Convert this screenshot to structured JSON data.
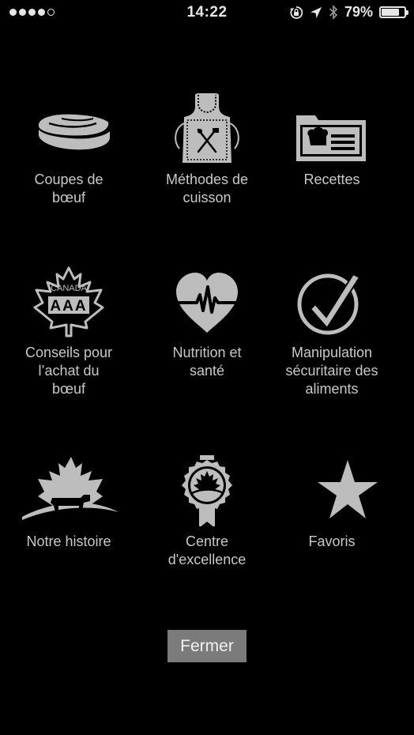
{
  "status_bar": {
    "signal_bars_filled": 4,
    "signal_bars_total": 5,
    "time": "14:22",
    "icons": [
      "orientation-lock-icon",
      "location-arrow-icon",
      "bluetooth-icon"
    ],
    "battery_percent": "79%",
    "battery_level": 0.79
  },
  "menu": {
    "items": [
      {
        "label": "Coupes de\nbœuf",
        "icon": "steak-icon"
      },
      {
        "label": "Méthodes de\ncuisson",
        "icon": "apron-icon"
      },
      {
        "label": "Recettes",
        "icon": "recipe-folder-icon"
      },
      {
        "label": "Conseils pour\nl’achat du\nbœuf",
        "icon": "canada-aaa-maple-icon",
        "icon_text_top": "CANADA",
        "icon_text_grade": "AAA"
      },
      {
        "label": "Nutrition et\nsanté",
        "icon": "heart-pulse-icon"
      },
      {
        "label": "Manipulation\nsécuritaire des\naliments",
        "icon": "checkmark-circle-icon"
      },
      {
        "label": "Notre histoire",
        "icon": "maple-leaf-cow-icon"
      },
      {
        "label": "Centre\nd'excellence",
        "icon": "award-medal-icon"
      },
      {
        "label": "Favoris",
        "icon": "star-icon"
      }
    ]
  },
  "close_button": {
    "label": "Fermer"
  },
  "colors": {
    "background": "#000000",
    "icon": "#bdbdbd",
    "text": "#c9c9c9",
    "button": "#7b7b7b"
  }
}
